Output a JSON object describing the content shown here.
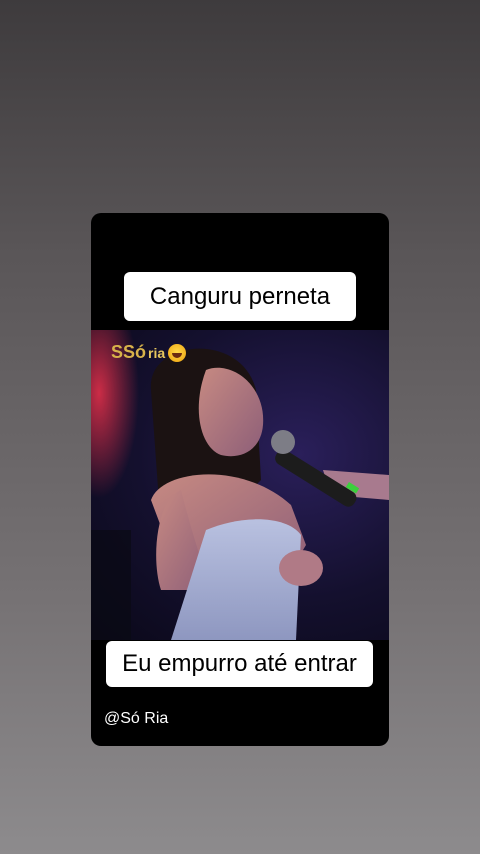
{
  "story": {
    "caption_top": "Canguru perneta",
    "caption_bottom": "Eu empurro até entrar",
    "handle": "@Só Ria",
    "logo": {
      "main": "SSó",
      "small": "ria",
      "icon": "laughing-emoji-icon"
    }
  },
  "colors": {
    "card_background": "#000000",
    "caption_background": "#ffffff",
    "caption_text": "#000000",
    "logo_gold": "#d7b24a"
  }
}
